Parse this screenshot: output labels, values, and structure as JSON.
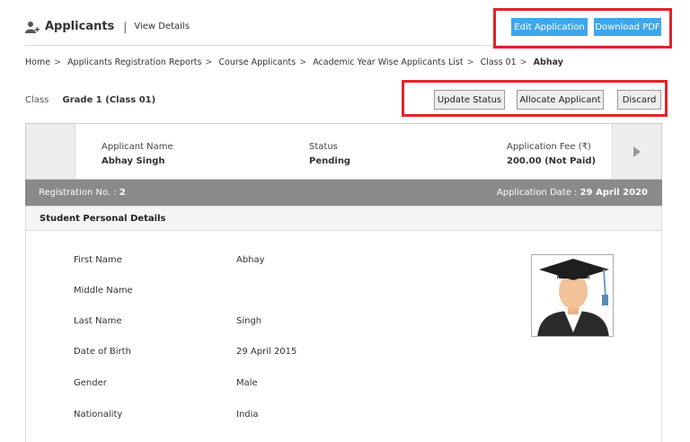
{
  "header": {
    "title": "Applicants",
    "separator": "|",
    "view_details": "View Details",
    "edit_application": "Edit Application",
    "download_pdf": "Download PDF"
  },
  "breadcrumb": [
    "Home",
    "Applicants Registration Reports",
    "Course Applicants",
    "Academic Year Wise Applicants List",
    "Class 01",
    "Abhay"
  ],
  "class_info": {
    "label": "Class",
    "value": "Grade 1 (Class 01)"
  },
  "actions": {
    "update_status": "Update Status",
    "allocate_applicant": "Allocate Applicant",
    "discard": "Discard"
  },
  "summary": {
    "name_label": "Applicant Name",
    "name_value": "Abhay Singh",
    "status_label": "Status",
    "status_value": "Pending",
    "fee_label": "Application Fee (₹)",
    "fee_value": "200.00 (Not Paid)"
  },
  "registration": {
    "no_label": "Registration No. :",
    "no_value": "2",
    "date_label": "Application Date :",
    "date_value": "29 April 2020"
  },
  "section_title": "Student Personal Details",
  "fields": [
    {
      "label": "First Name",
      "value": "Abhay"
    },
    {
      "label": "Middle Name",
      "value": ""
    },
    {
      "label": "Last Name",
      "value": "Singh"
    },
    {
      "label": "Date of Birth",
      "value": "29 April 2015"
    },
    {
      "label": "Gender",
      "value": "Male"
    },
    {
      "label": "Nationality",
      "value": "India"
    }
  ],
  "colors": {
    "accent_blue": "#3fa6ea",
    "highlight_red": "#e2232a",
    "bar_grey": "#8a8a8a"
  },
  "icons": {
    "title": "user-add-icon",
    "next": "triangle-right-icon",
    "photo": "graduate-avatar-icon"
  }
}
